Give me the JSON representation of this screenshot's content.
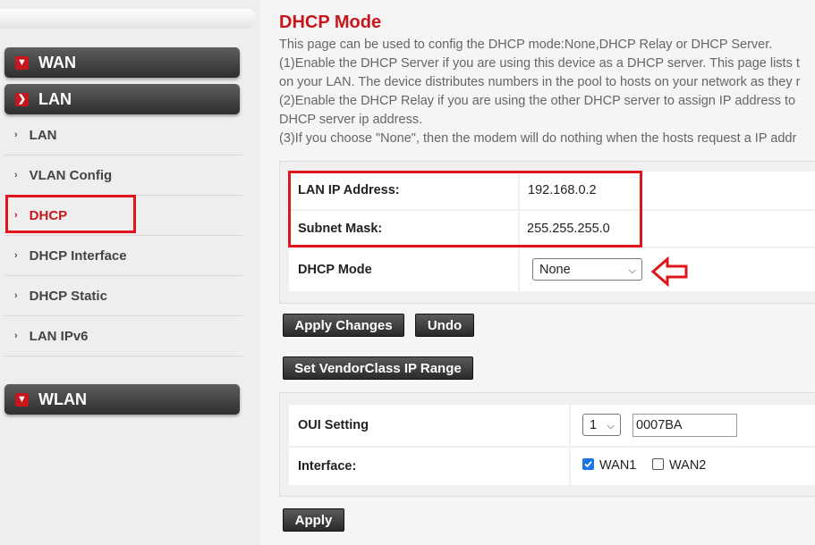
{
  "sidebar": {
    "sections": {
      "wan": "WAN",
      "lan": "LAN",
      "wlan": "WLAN"
    },
    "items": [
      {
        "label": "LAN"
      },
      {
        "label": "VLAN Config"
      },
      {
        "label": "DHCP"
      },
      {
        "label": "DHCP Interface"
      },
      {
        "label": "DHCP Static"
      },
      {
        "label": "LAN IPv6"
      }
    ]
  },
  "page": {
    "title": "DHCP Mode",
    "description": [
      "This page can be used to config the DHCP mode:None,DHCP Relay or DHCP Server.",
      "(1)Enable the DHCP Server if you are using this device as a DHCP server. This page lists t",
      "on your LAN. The device distributes numbers in the pool to hosts on your network as they r",
      "(2)Enable the DHCP Relay if you are using the other DHCP server to assign IP address to",
      "DHCP server ip address.",
      "(3)If you choose \"None\", then the modem will do nothing when the hosts request a IP addr"
    ]
  },
  "settings": {
    "lan_ip_label": "LAN IP Address:",
    "lan_ip_value": "192.168.0.2",
    "subnet_label": "Subnet Mask:",
    "subnet_value": "255.255.255.0",
    "dhcp_mode_label": "DHCP Mode",
    "dhcp_mode_value": "None"
  },
  "buttons": {
    "apply_changes": "Apply Changes",
    "undo": "Undo",
    "set_vendor_class": "Set VendorClass IP Range",
    "apply": "Apply"
  },
  "oui": {
    "setting_label": "OUI Setting",
    "index_value": "1",
    "value": "0007BA",
    "interface_label": "Interface:",
    "wan1": {
      "label": "WAN1",
      "checked": true
    },
    "wan2": {
      "label": "WAN2",
      "checked": false
    }
  },
  "colors": {
    "accent": "#c8161d",
    "highlight": "#e0141c"
  }
}
